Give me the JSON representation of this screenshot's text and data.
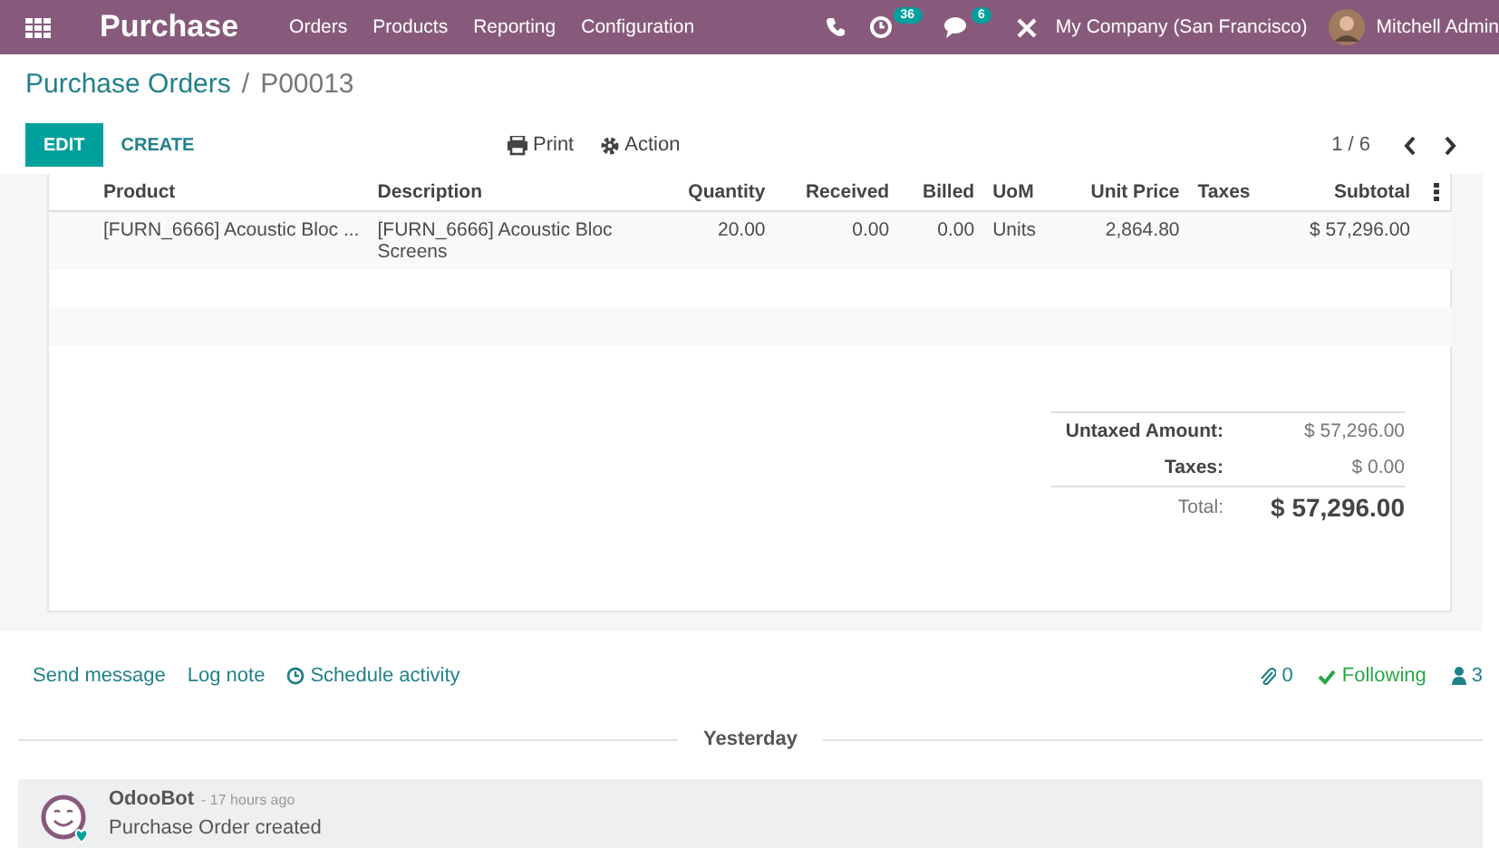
{
  "navbar": {
    "app_name": "Purchase",
    "menu": [
      "Orders",
      "Products",
      "Reporting",
      "Configuration"
    ],
    "activity_count": "36",
    "message_count": "6",
    "company": "My Company (San Francisco)",
    "user": "Mitchell Admin"
  },
  "breadcrumb": {
    "parent": "Purchase Orders",
    "separator": "/",
    "current": "P00013"
  },
  "control_panel": {
    "buttons": [
      {
        "label": "EDIT",
        "kind": "primary"
      },
      {
        "label": "CREATE",
        "kind": "secondary"
      }
    ],
    "actions": [
      "Print",
      "Action"
    ],
    "pager": "1 / 6"
  },
  "table": {
    "columns": [
      {
        "label": "Product",
        "kind": "text"
      },
      {
        "label": "Description",
        "kind": "text"
      },
      {
        "label": "Quantity",
        "kind": "number"
      },
      {
        "label": "Received",
        "kind": "number"
      },
      {
        "label": "Billed",
        "kind": "number"
      },
      {
        "label": "UoM",
        "kind": "text"
      },
      {
        "label": "Unit Price",
        "kind": "number"
      },
      {
        "label": "Taxes",
        "kind": "text"
      },
      {
        "label": "Subtotal",
        "kind": "number"
      }
    ],
    "rows": [
      [
        "[FURN_6666] Acoustic Bloc ...",
        "[FURN_6666] Acoustic Bloc Screens",
        "20.00",
        "0.00",
        "0.00",
        "Units",
        "2,864.80",
        "",
        "$ 57,296.00"
      ]
    ]
  },
  "totals": [
    {
      "label": "Untaxed Amount:",
      "value": "$ 57,296.00",
      "kind": "line"
    },
    {
      "label": "Taxes:",
      "value": "$ 0.00",
      "kind": "line"
    },
    {
      "label": "Total:",
      "value": "$ 57,296.00",
      "kind": "grand"
    }
  ],
  "chatter": {
    "actions": [
      "Send message",
      "Log note",
      "Schedule activity"
    ],
    "attachments": "0",
    "following": "Following",
    "followers": "3",
    "date_separator": "Yesterday",
    "messages": [
      {
        "author": "OdooBot",
        "time": "- 17 hours ago",
        "body": "Purchase Order created"
      }
    ]
  }
}
